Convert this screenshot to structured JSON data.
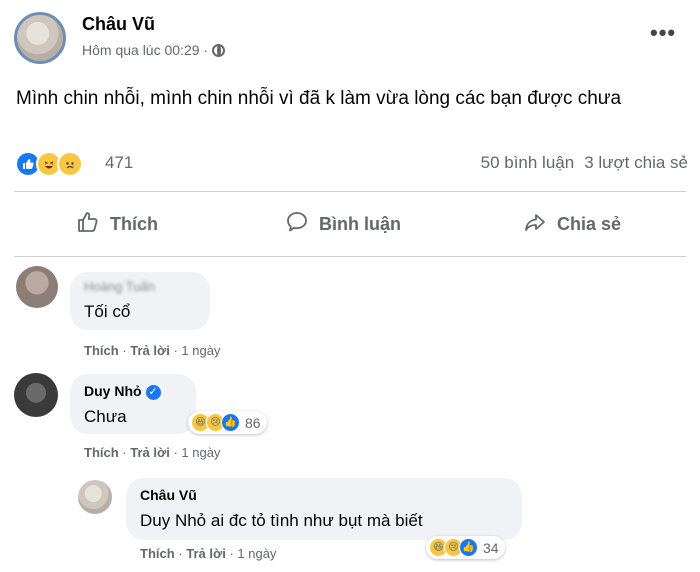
{
  "post": {
    "author": "Châu Vũ",
    "timestamp": "Hôm qua lúc 00:29 ·",
    "privacy_icon": "globe-icon",
    "more_label": "•••",
    "text": "Mình chin nhỗi, mình chin nhỗi vì đã k làm vừa lòng các bạn được chưa",
    "reaction_icons": [
      "like-icon",
      "haha-icon",
      "sad-icon"
    ],
    "reaction_count": "471",
    "comment_count": "50 bình luận",
    "share_count": "3 lượt chia sẻ"
  },
  "actions": {
    "like": "Thích",
    "comment": "Bình luận",
    "share": "Chia sẻ"
  },
  "comments": [
    {
      "author": "Hoàng Tuấn",
      "text": "Tối cổ",
      "like": "Thích",
      "reply": "Trả lời",
      "age": "· 1 ngày"
    },
    {
      "author": "Duy Nhỏ",
      "verified": true,
      "text": "Chưa",
      "reaction_count": "86",
      "like": "Thích",
      "reply": "Trả lời",
      "age": "· 1 ngày",
      "replies": [
        {
          "author": "Châu Vũ",
          "text": "Duy Nhỏ ai đc tỏ tình như bụt mà biết",
          "reaction_count": "34",
          "like": "Thích",
          "reply": "Trả lời",
          "age": "· 1 ngày"
        }
      ]
    }
  ],
  "colors": {
    "brand_blue": "#1877f2",
    "secondary_text": "#65676b",
    "bubble_bg": "#f0f2f5"
  }
}
